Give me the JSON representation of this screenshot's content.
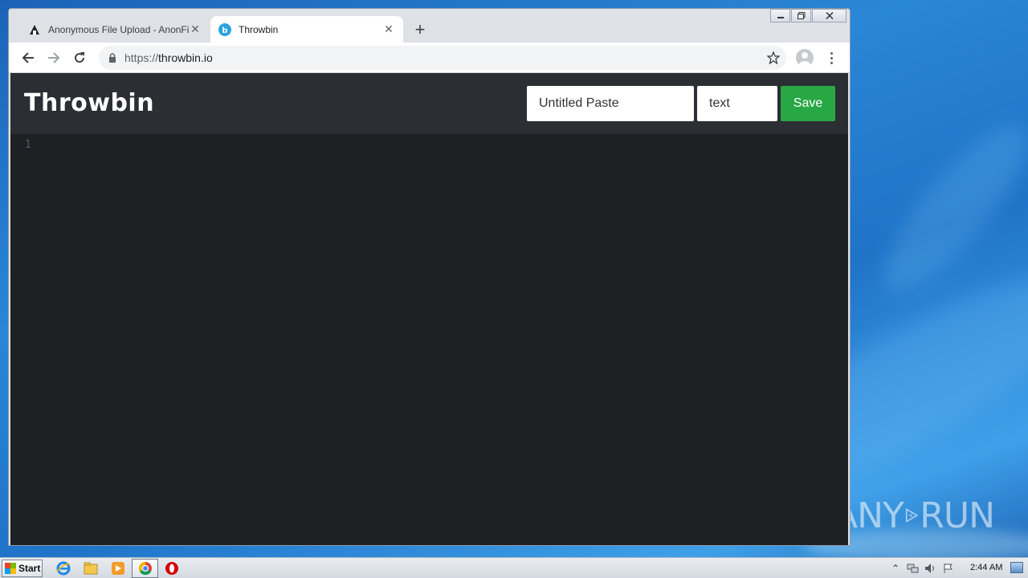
{
  "browser": {
    "tabs": [
      {
        "title": "Anonymous File Upload - AnonFile",
        "active": false,
        "icon": "anonfile-icon"
      },
      {
        "title": "Throwbin",
        "active": true,
        "icon": "throwbin-icon"
      }
    ],
    "url_scheme": "https://",
    "url_host": "throwbin.io"
  },
  "app": {
    "logo_text": "Throwbin",
    "title_input_value": "Untitled Paste",
    "language_input_value": "text",
    "save_label": "Save",
    "line_numbers": [
      "1"
    ]
  },
  "taskbar": {
    "start_label": "Start",
    "clock": "2:44 AM"
  },
  "watermark": {
    "left": "ANY",
    "right": "RUN"
  },
  "colors": {
    "save_button": "#28a745",
    "page_header": "#2b2f33",
    "editor_bg": "#1e2124",
    "desktop": "#1f73c8"
  }
}
